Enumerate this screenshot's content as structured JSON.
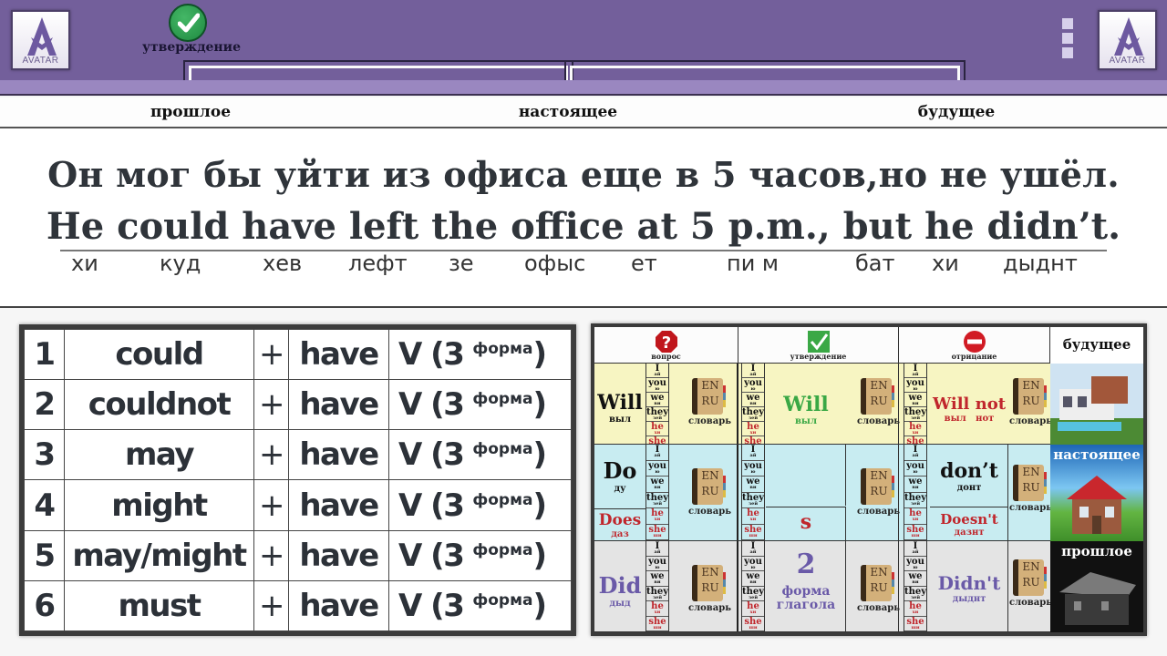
{
  "header": {
    "logo_text": "AVATAR",
    "mode_icon": "check-icon",
    "mode_label": "утверждение",
    "menu_icon": "vertical-dots-icon"
  },
  "tenses": {
    "past": "прошлое",
    "present": "настоящее",
    "future": "будущее"
  },
  "sentence": {
    "russian": "Он мог бы уйти из офиса еще в 5 часов,но не ушёл.",
    "english": "He could have left the office at 5 p.m., but he didn’t.",
    "transcription": [
      "хи",
      "куд",
      "хев",
      "лефт",
      "зе",
      "офыс",
      "ет",
      "пи м",
      "бат",
      "хи",
      "дыднт"
    ]
  },
  "formula_table": {
    "rows": [
      {
        "num": "1",
        "modal": "could",
        "plus": "+",
        "have": "have",
        "verb": "V (3",
        "forma": "форма",
        "close": ")"
      },
      {
        "num": "2",
        "modal": "couldnot",
        "plus": "+",
        "have": "have",
        "verb": "V (3",
        "forma": "форма",
        "close": ")"
      },
      {
        "num": "3",
        "modal": "may",
        "plus": "+",
        "have": "have",
        "verb": "V (3",
        "forma": "форма",
        "close": ")"
      },
      {
        "num": "4",
        "modal": "might",
        "plus": "+",
        "have": "have",
        "verb": "V (3",
        "forma": "форма",
        "close": ")"
      },
      {
        "num": "5",
        "modal": "may/might",
        "plus": "+",
        "have": "have",
        "verb": "V (3",
        "forma": "форма",
        "close": ")"
      },
      {
        "num": "6",
        "modal": "must",
        "plus": "+",
        "have": "have",
        "verb": "V (3",
        "forma": "форма",
        "close": ")"
      }
    ]
  },
  "grammar_chart": {
    "headers": {
      "question": {
        "icon": "question-stop-icon",
        "label": "вопрос"
      },
      "affirmative": {
        "icon": "green-check-icon",
        "label": "утверждение"
      },
      "negative": {
        "icon": "no-entry-icon",
        "label": "отрицание"
      }
    },
    "pronouns": [
      {
        "en": "I",
        "ru": "ай"
      },
      {
        "en": "you",
        "ru": "ю"
      },
      {
        "en": "we",
        "ru": "ви"
      },
      {
        "en": "they",
        "ru": "зей"
      },
      {
        "en": "he",
        "ru": "хи"
      },
      {
        "en": "she",
        "ru": "ши"
      }
    ],
    "dictionary": {
      "top": "EN",
      "bottom": "RU",
      "label": "словарь"
    },
    "future": {
      "image_label": "будущее",
      "question": {
        "en": "Will",
        "ru": "выл"
      },
      "affirmative": {
        "en": "Will",
        "ru": "выл"
      },
      "negative": {
        "en": "Will not",
        "ru": "выл   нот"
      }
    },
    "present": {
      "image_label": "настоящее",
      "question": {
        "en": "Do",
        "ru": "ду"
      },
      "question_3rd": {
        "en": "Does",
        "ru": "даз"
      },
      "affirmative_3rd": "s",
      "negative": {
        "en": "don’t",
        "ru": "донт"
      },
      "negative_3rd": {
        "en": "Doesn't",
        "ru": "дазнт"
      }
    },
    "past": {
      "image_label": "прошлое",
      "question": {
        "en": "Did",
        "ru": "дыд"
      },
      "affirmative_num": "2",
      "affirmative_text": "форма глагола",
      "negative": {
        "en": "Didn't",
        "ru": "дыднт"
      }
    },
    "colors": {
      "future_bg": "#f7f5c2",
      "present_bg": "#c8ecf1",
      "past_bg": "#e4e4e4",
      "red": "#c0262c",
      "green": "#3aa845",
      "purple": "#6a5aa8"
    }
  }
}
